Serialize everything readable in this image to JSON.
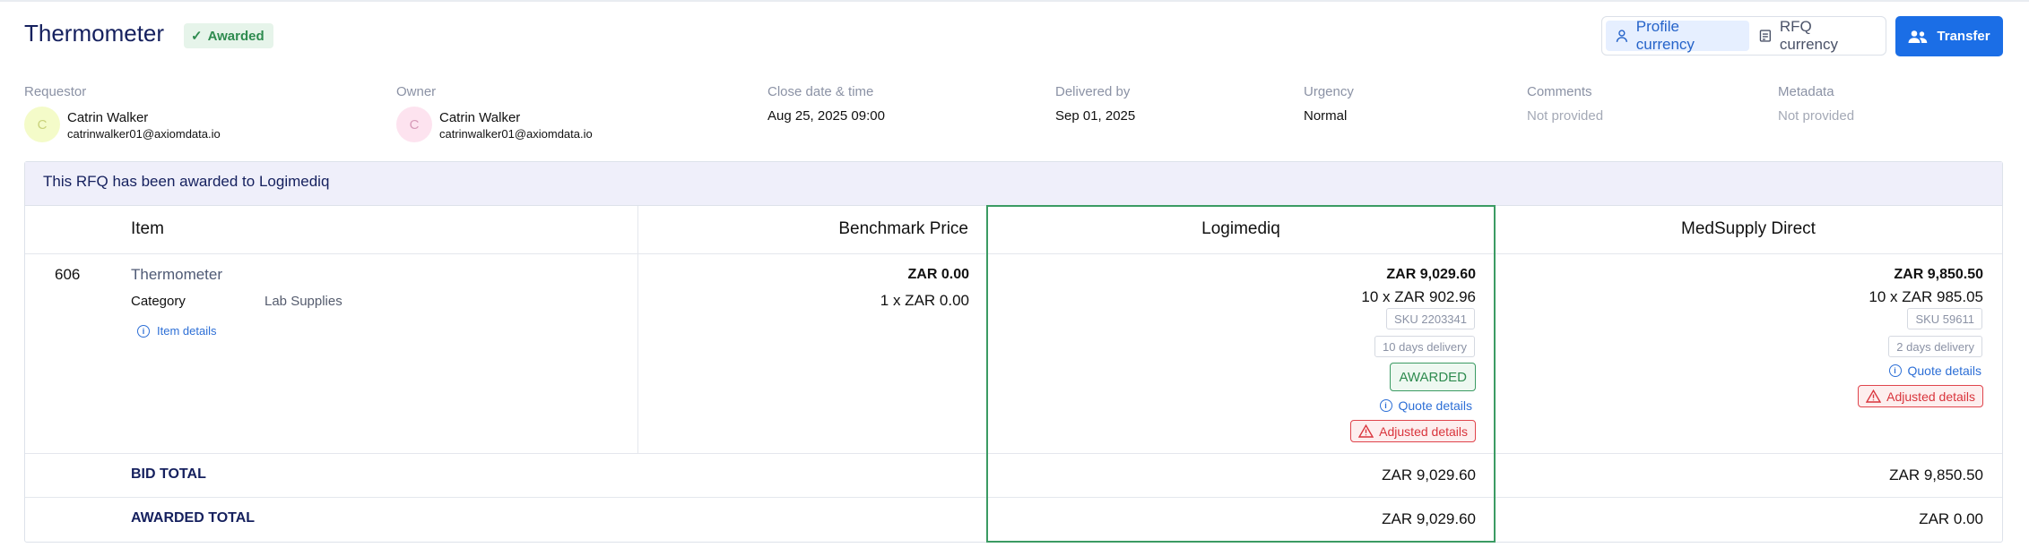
{
  "header": {
    "title": "Thermometer",
    "status_badge": "Awarded",
    "currency_options": [
      "Profile currency",
      "RFQ currency"
    ],
    "transfer_label": "Transfer"
  },
  "meta": {
    "requestor": {
      "label": "Requestor",
      "initial": "C",
      "name": "Catrin Walker",
      "email": "catrinwalker01@axiomdata.io"
    },
    "owner": {
      "label": "Owner",
      "initial": "C",
      "name": "Catrin Walker",
      "email": "catrinwalker01@axiomdata.io"
    },
    "close": {
      "label": "Close date & time",
      "value": "Aug 25, 2025 09:00"
    },
    "delivered": {
      "label": "Delivered by",
      "value": "Sep 01, 2025"
    },
    "urgency": {
      "label": "Urgency",
      "value": "Normal"
    },
    "comments": {
      "label": "Comments",
      "value": "Not provided"
    },
    "metadata": {
      "label": "Metadata",
      "value": "Not provided"
    }
  },
  "banner": "This RFQ has been awarded to Logimediq",
  "table": {
    "headers": {
      "item": "Item",
      "benchmark": "Benchmark Price",
      "supplier1": "Logimediq",
      "supplier2": "MedSupply Direct"
    },
    "row": {
      "number": "606",
      "name": "Thermometer",
      "category_label": "Category",
      "category_value": "Lab Supplies",
      "item_details": "Item details",
      "benchmark": {
        "total": "ZAR 0.00",
        "unit": "1 x ZAR 0.00"
      },
      "supplier1": {
        "total": "ZAR 9,029.60",
        "unit": "10 x ZAR 902.96",
        "sku": "SKU 2203341",
        "delivery": "10 days delivery",
        "awarded": "AWARDED",
        "quote_details": "Quote details",
        "adjusted": "Adjusted details"
      },
      "supplier2": {
        "total": "ZAR 9,850.50",
        "unit": "10 x ZAR 985.05",
        "sku": "SKU 59611",
        "delivery": "2 days delivery",
        "quote_details": "Quote details",
        "adjusted": "Adjusted details"
      }
    },
    "bid_total": {
      "label": "BID TOTAL",
      "supplier1": "ZAR 9,029.60",
      "supplier2": "ZAR 9,850.50"
    },
    "awarded_total": {
      "label": "AWARDED TOTAL",
      "supplier1": "ZAR 9,029.60",
      "supplier2": "ZAR 0.00"
    }
  },
  "colors": {
    "accent": "#1b6ee6",
    "awarded_green": "#3b9b63",
    "warning_red": "#e0444c",
    "title_navy": "#15205e"
  }
}
